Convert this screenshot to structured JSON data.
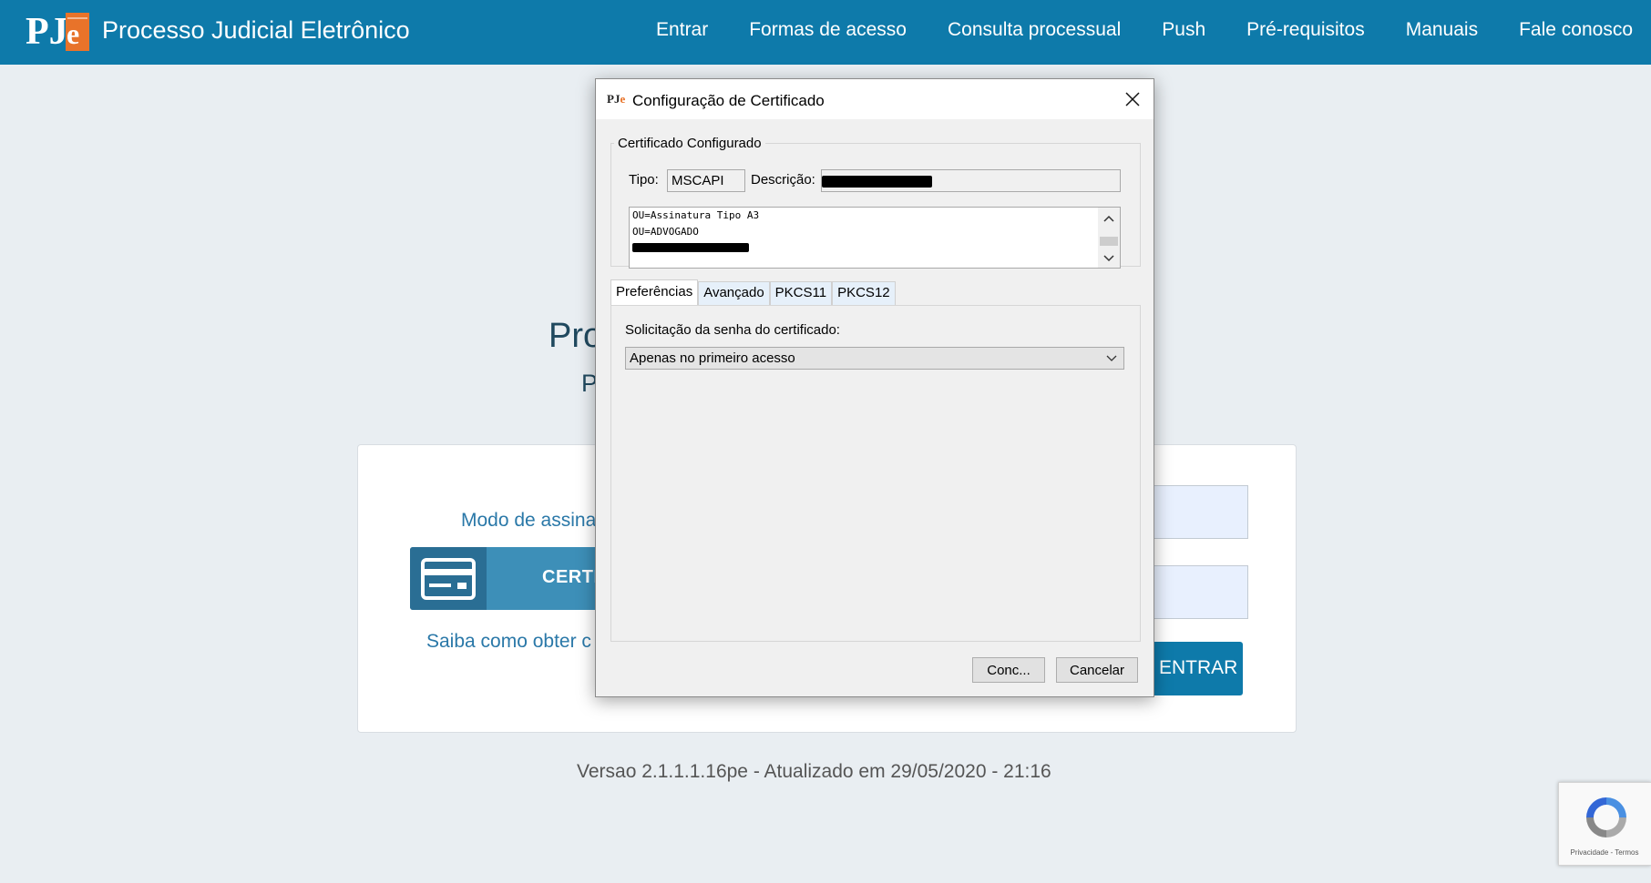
{
  "header": {
    "logo_text": "PJe",
    "title": "Processo Judicial Eletrônico",
    "nav": [
      "Entrar",
      "Formas de acesso",
      "Consulta processual",
      "Push",
      "Pré-requisitos",
      "Manuais",
      "Fale conosco"
    ]
  },
  "background": {
    "heading_partial": "Pro",
    "subheading_partial": "P",
    "mode_label_partial": "Modo de assina",
    "cert_button_partial": "CERTIF",
    "learn_link_partial": "Saiba como obter c",
    "enter_button": "ENTRAR",
    "version": "Versao 2.1.1.1.16pe - Atualizado em 29/05/2020 - 21:16",
    "recaptcha_text": "Privacidade - Termos"
  },
  "dialog": {
    "icon_text": "PJe",
    "title": "Configuração de Certificado",
    "group_label": "Certificado Configurado",
    "tipo_label": "Tipo:",
    "tipo_value": "MSCAPI",
    "descricao_label": "Descrição:",
    "details_lines": [
      "OU=Assinatura Tipo A3",
      "OU=ADVOGADO"
    ],
    "tabs": [
      "Preferências",
      "Avançado",
      "PKCS11",
      "PKCS12"
    ],
    "active_tab": "Preferências",
    "password_label": "Solicitação da senha do certificado:",
    "password_option": "Apenas no primeiro acesso",
    "confirm_button": "Conc...",
    "cancel_button": "Cancelar"
  },
  "colors": {
    "header_bg": "#0e7aaa",
    "accent_orange": "#e8732a",
    "link_blue": "#2a78a8"
  }
}
